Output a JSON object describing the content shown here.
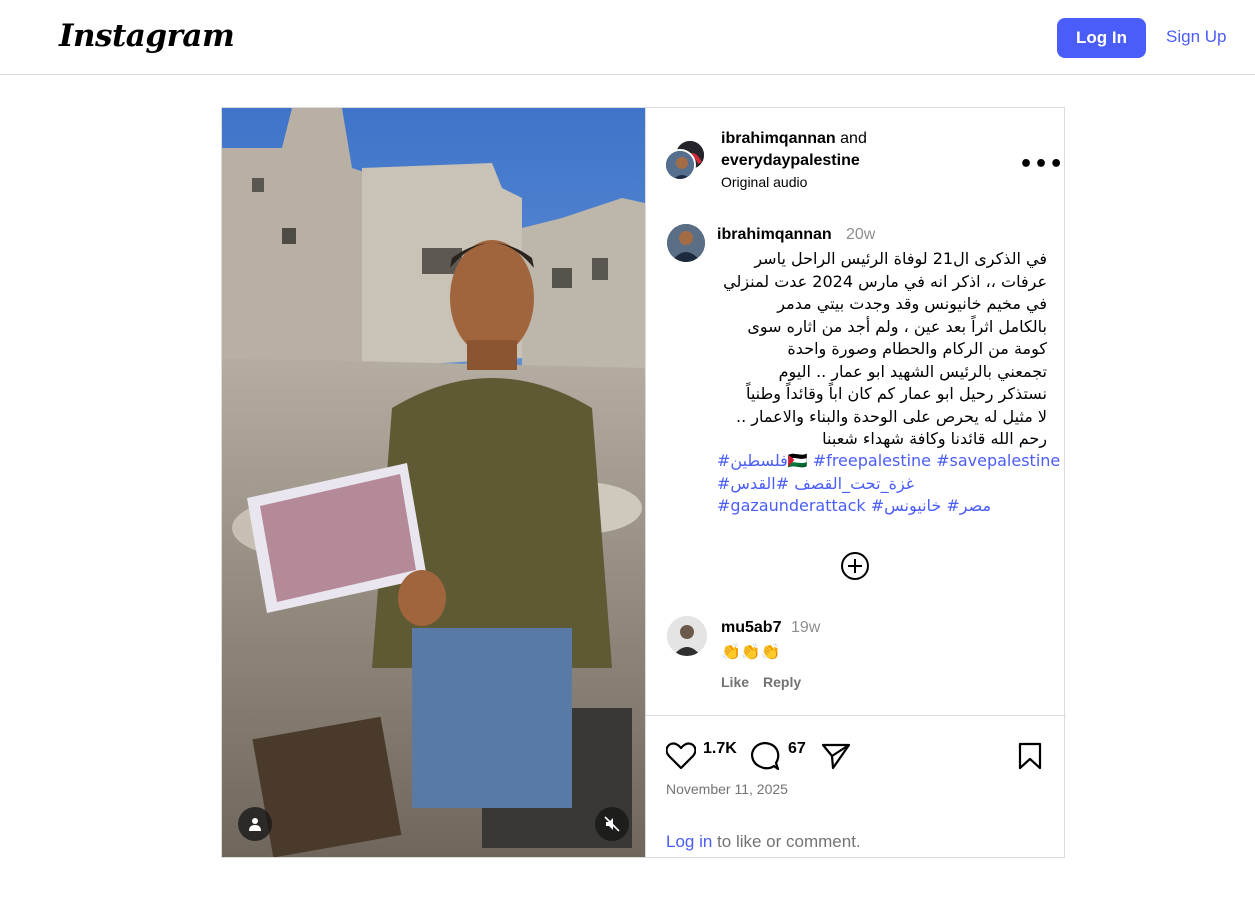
{
  "brand": {
    "logo_text": "Instagram"
  },
  "nav": {
    "login_label": "Log In",
    "signup_label": "Sign Up"
  },
  "post": {
    "header": {
      "author": "ibrahimqannan",
      "joiner": "and",
      "collaborator": "everydaypalestine",
      "audio": "Original audio",
      "more_label": "•••"
    },
    "caption": {
      "username": "ibrahimqannan",
      "age": "20w",
      "text": "في الذكرى ال21 لوفاة الرئيس الراحل ياسر\nعرفات ،، اذكر انه في مارس 2024 عدت لمنزلي\nفي مخيم خانيونس وقد وجدت بيتي مدمر\nبالكامل اثراً بعد عين ، ولم أجد من اثاره سوى\nكومة من الركام والحطام  وصورة واحدة\nتجمعني بالرئيس الشهيد ابو عمار .. اليوم\nنستذكر رحيل ابو عمار كم كان اباً وقائداً وطنياً\nلا مثيل له يحرص على الوحدة والبناء والاعمار ..\nرحم الله قائدنا وكافة شهداء شعبنا",
      "hashtag_lines": [
        "#فلسطين🇵🇸 #freepalestine #savepalestine",
        "#غزة_تحت_القصف #القدس",
        "#gazaunderattack #مصر# خانيونس"
      ]
    },
    "comment": {
      "username": "mu5ab7",
      "age": "19w",
      "text": "👏👏👏",
      "like_label": "Like",
      "reply_label": "Reply"
    },
    "stats": {
      "likes": "1.7K",
      "comments": "67"
    },
    "date": "November 11, 2025",
    "cta": {
      "link": "Log in",
      "rest": " to like or comment."
    }
  }
}
